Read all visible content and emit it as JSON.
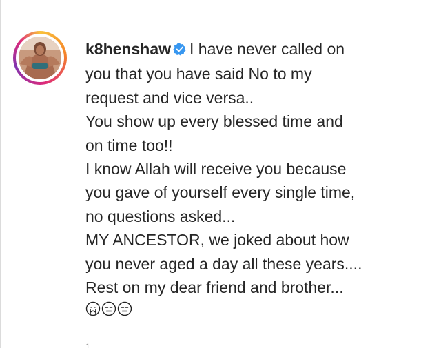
{
  "comment": {
    "username": "k8henshaw",
    "verified": true,
    "lines": [
      "I have never called on",
      "you that you have said No to my",
      "request and vice versa..",
      "You show up every blessed time and",
      "on time too!!",
      "I know Allah will receive you because",
      "you gave of yourself every single time,",
      "no questions asked...",
      "MY ANCESTOR, we joked about how",
      "you never aged a day all these years....",
      "Rest on my dear friend and brother..."
    ],
    "emojis": [
      "crying-face-emoji",
      "expressionless-face-emoji",
      "expressionless-face-emoji"
    ],
    "footer_stub": "1"
  },
  "colors": {
    "text": "#262626",
    "verified_badge": "#3897f0",
    "secondary": "#8e8e8e"
  }
}
